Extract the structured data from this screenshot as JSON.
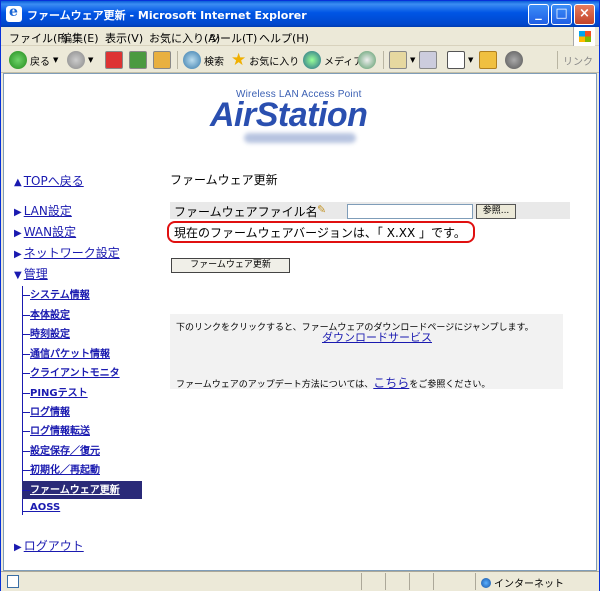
{
  "window": {
    "title": "ファームウェア更新 - Microsoft Internet Explorer",
    "controls": [
      "_",
      "□",
      "×"
    ]
  },
  "menu": [
    "ファイル(F)",
    "編集(E)",
    "表示(V)",
    "お気に入り(A)",
    "ツール(T)",
    "ヘルプ(H)"
  ],
  "toolbar": {
    "back": "戻る",
    "search": "検索",
    "favorites": "お気に入り",
    "media": "メディア",
    "links": "リンク"
  },
  "logo": {
    "sub": "Wireless LAN Access Point",
    "main": "AirStation"
  },
  "nav": {
    "top": "TOPへ戻る",
    "lan": "LAN設定",
    "wan": "WAN設定",
    "network": "ネットワーク設定",
    "admin": "管理",
    "sub": [
      "システム情報",
      "本体設定",
      "時刻設定",
      "通信パケット情報",
      "クライアントモニタ",
      "PINGテスト",
      "ログ情報",
      "ログ情報転送",
      "設定保存／復元",
      "初期化／再起動",
      "ファームウェア更新",
      "AOSS"
    ],
    "logout": "ログアウト"
  },
  "main": {
    "title": "ファームウェア更新",
    "file_label": "ファームウェアファイル名",
    "browse": "参照...",
    "version_text": "現在のファームウェアバージョンは、「 X.XX 」です。",
    "update_button": "ファームウェア更新",
    "info1": "下のリンクをクリックすると、ファームウェアのダウンロードページにジャンプします。",
    "download_link": "ダウンロードサービス",
    "info2_pre": "ファームウェアのアップデート方法については、",
    "info2_link": "こちら",
    "info2_post": "をご参照ください。"
  },
  "status": {
    "zone": "インターネット"
  }
}
